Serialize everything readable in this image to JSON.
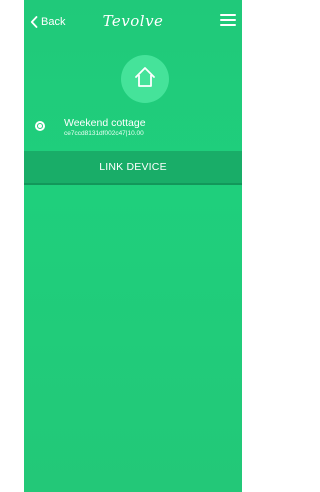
{
  "header": {
    "back_label": "Back",
    "logo_text": "Tevolve",
    "back_icon": "chevron-left-icon",
    "menu_icon": "hamburger-menu-icon"
  },
  "home": {
    "icon": "house-icon"
  },
  "device": {
    "name": "Weekend cottage",
    "id": "ce7ccd8131df002c47|10.00",
    "selected": true
  },
  "actions": {
    "link_device_label": "LINK DEVICE"
  },
  "colors": {
    "background": "#1fcf7c",
    "circle": "#45e39a",
    "button": "#19ad68"
  }
}
